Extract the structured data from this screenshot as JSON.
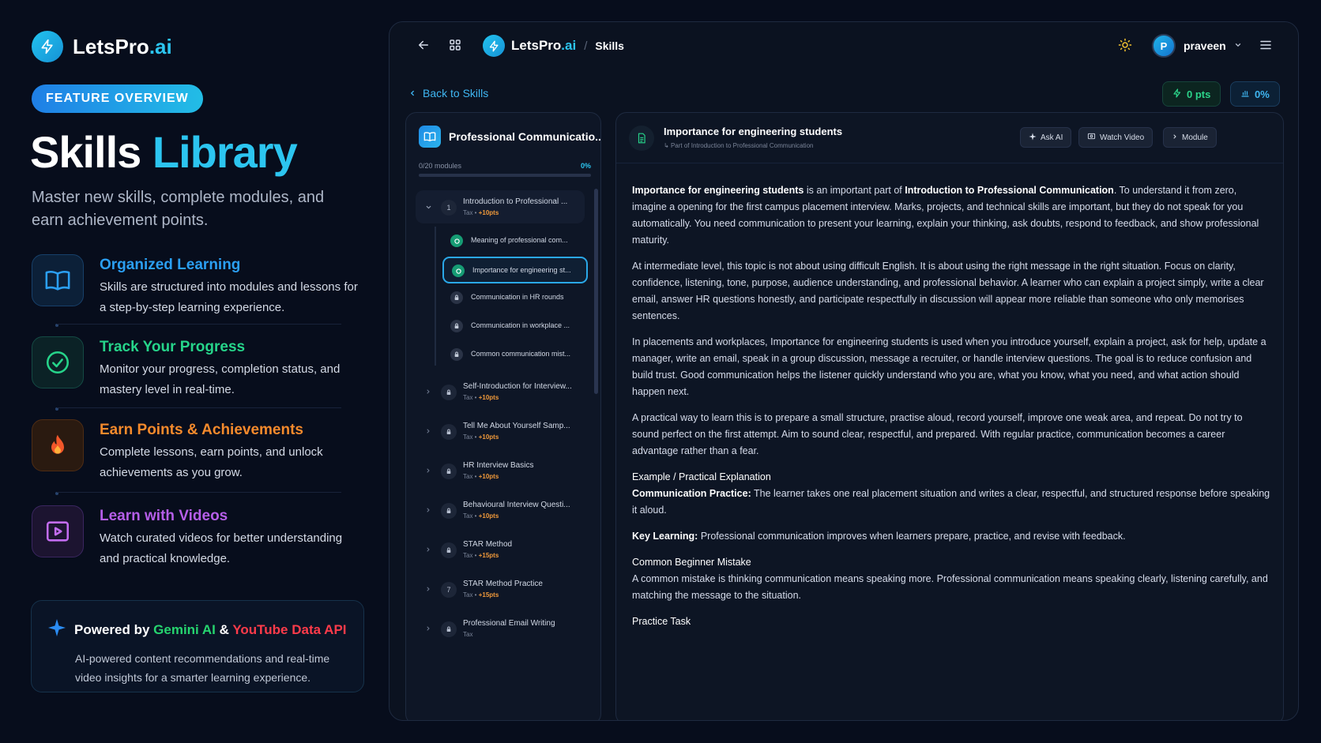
{
  "brand": {
    "name_main": "LetsPro",
    "name_accent": ".ai"
  },
  "pill": "FEATURE OVERVIEW",
  "hero": {
    "title_main": "Skills",
    "title_accent": "Library",
    "subtitle": "Master new skills, complete modules, and earn achievement points."
  },
  "features": [
    {
      "title": "Organized Learning",
      "desc": "Skills are structured into modules and lessons for a step-by-step learning experience.",
      "color": "#2b9ff2",
      "icon": "book-icon"
    },
    {
      "title": "Track Your Progress",
      "desc": "Monitor your progress, completion status, and mastery level in real-time.",
      "color": "#26d48a",
      "icon": "check-circle-icon"
    },
    {
      "title": "Earn Points & Achievements",
      "desc": "Complete lessons, earn points, and unlock achievements as you grow.",
      "color": "#f58a2c",
      "icon": "flame-icon"
    },
    {
      "title": "Learn with Videos",
      "desc": "Watch curated videos for better understanding and practical knowledge.",
      "color": "#b55ee8",
      "icon": "play-icon"
    }
  ],
  "powered": {
    "prefix": "Powered by",
    "gemini": "Gemini AI",
    "amp": "&",
    "youtube": "YouTube Data API",
    "desc": "AI-powered content recommendations and real-time video insights for a smarter learning experience."
  },
  "app": {
    "topbar": {
      "brand_main": "LetsPro",
      "brand_accent": ".ai",
      "sep": "/",
      "crumb": "Skills",
      "user_initial": "P",
      "user_name": "praveen"
    },
    "back_label": "Back to Skills",
    "points": "0 pts",
    "percent": "0%",
    "sidebar": {
      "title": "Professional Communicatio...",
      "progress_label": "0/20 modules",
      "progress_pct": "0%",
      "progress_value": 0,
      "open_module": {
        "num": "1",
        "title": "Introduction to Professional ...",
        "tag": "Tax",
        "pts": "+10pts"
      },
      "lessons": [
        {
          "title": "Meaning of professional com...",
          "state": "done"
        },
        {
          "title": "Importance for engineering st...",
          "state": "active"
        },
        {
          "title": "Communication in HR rounds",
          "state": "locked"
        },
        {
          "title": "Communication in workplace ...",
          "state": "locked"
        },
        {
          "title": "Common communication mist...",
          "state": "locked"
        }
      ],
      "modules": [
        {
          "title": "Self-Introduction for Interview...",
          "tag": "Tax",
          "pts": "+10pts",
          "badge": "lock"
        },
        {
          "title": "Tell Me About Yourself Samp...",
          "tag": "Tax",
          "pts": "+10pts",
          "badge": "lock"
        },
        {
          "title": "HR Interview Basics",
          "tag": "Tax",
          "pts": "+10pts",
          "badge": "lock"
        },
        {
          "title": "Behavioural Interview Questi...",
          "tag": "Tax",
          "pts": "+10pts",
          "badge": "lock"
        },
        {
          "title": "STAR Method",
          "tag": "Tax",
          "pts": "+15pts",
          "badge": "lock"
        },
        {
          "title": "STAR Method Practice",
          "tag": "Tax",
          "pts": "+15pts",
          "badge": "7"
        },
        {
          "title": "Professional Email Writing",
          "tag": "Tax",
          "pts": "",
          "badge": "lock"
        }
      ]
    },
    "lesson": {
      "title": "Importance for engineering students",
      "subtitle": "Part of Introduction to Professional Communication",
      "ask_ai": "Ask AI",
      "watch_video": "Watch Video",
      "module": "Module",
      "p1_b1": "Importance for engineering students",
      "p1_t1": " is an important part of ",
      "p1_b2": "Introduction to Professional Communication",
      "p1_t2": ". To understand it from zero, imagine a opening for the first campus placement interview. Marks, projects, and technical skills are important, but they do not speak for you automatically. You need communication to present your learning, explain your thinking, ask doubts, respond to feedback, and show professional maturity.",
      "p2": "At intermediate level, this topic is not about using difficult English. It is about using the right message in the right situation. Focus on clarity, confidence, listening, tone, purpose, audience understanding, and professional behavior. A learner who can explain a project simply, write a clear email, answer HR questions honestly, and participate respectfully in discussion will appear more reliable than someone who only memorises sentences.",
      "p3": "In placements and workplaces, Importance for engineering students is used when you introduce yourself, explain a project, ask for help, update a manager, write an email, speak in a group discussion, message a recruiter, or handle interview questions. The goal is to reduce confusion and build trust. Good communication helps the listener quickly understand who you are, what you know, what you need, and what action should happen next.",
      "p4": "A practical way to learn this is to prepare a small structure, practise aloud, record yourself, improve one weak area, and repeat. Do not try to sound perfect on the first attempt. Aim to sound clear, respectful, and prepared. With regular practice, communication becomes a career advantage rather than a fear.",
      "ex_heading": "Example / Practical Explanation",
      "ex_label": "Communication Practice:",
      "ex_text": " The learner takes one real placement situation and writes a clear, respectful, and structured response before speaking it aloud.",
      "key_label": "Key Learning:",
      "key_text": " Professional communication improves when learners prepare, practice, and revise with feedback.",
      "mistake_heading": "Common Beginner Mistake",
      "mistake_text": "A common mistake is thinking communication means speaking more. Professional communication means speaking clearly, listening carefully, and matching the message to the situation.",
      "task_heading": "Practice Task"
    }
  }
}
